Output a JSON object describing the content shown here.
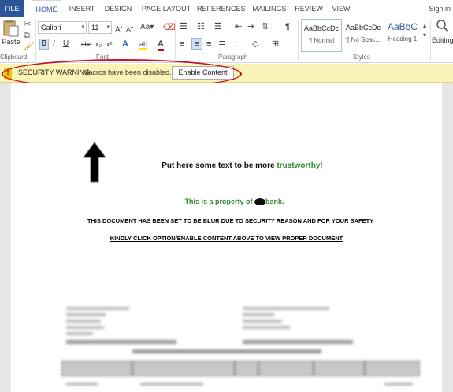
{
  "tabs": [
    "FILE",
    "HOME",
    "INSERT",
    "DESIGN",
    "PAGE LAYOUT",
    "REFERENCES",
    "MAILINGS",
    "REVIEW",
    "VIEW"
  ],
  "signin": "Sign in",
  "ribbon": {
    "paste_label": "Paste",
    "font_name": "Calibri",
    "font_size": "11",
    "group_clipboard": "Clipboard",
    "group_font": "Font",
    "group_paragraph": "Paragraph",
    "group_styles": "Styles",
    "styles": [
      {
        "sample": "AaBbCcDc",
        "name": "¶ Normal"
      },
      {
        "sample": "AaBbCcDc",
        "name": "¶ No Spac..."
      },
      {
        "sample": "AaBbC",
        "name": "Heading 1"
      }
    ],
    "editing_label": "Editing",
    "bold": "B",
    "italic": "I",
    "underline": "U",
    "strike": "abc",
    "sub": "x₂",
    "sup": "x²"
  },
  "security_bar": {
    "title": "SECURITY WARNING",
    "message": "Macros have been disabled.",
    "button": "Enable Content"
  },
  "document": {
    "line1_prefix": "Put here some text to be more ",
    "line1_green": "trustworthy!",
    "line2_prefix": "This is a property of ",
    "line2_suffix": "bank.",
    "line3": "THIS DOCUMENT HAS BEEN SET TO BE BLUR DUE TO SECURITY REASON AND FOR YOUR SAFETY",
    "line4": "KINDLY CLICK OPTION/ENABLE CONTENT ABOVE TO VIEW PROPER DOCUMENT"
  },
  "colors": {
    "file_tab": "#2b579a",
    "warning_bar": "#fcf3b6",
    "highlight_oval": "#c8102e",
    "green_text": "#2e8b2e"
  }
}
